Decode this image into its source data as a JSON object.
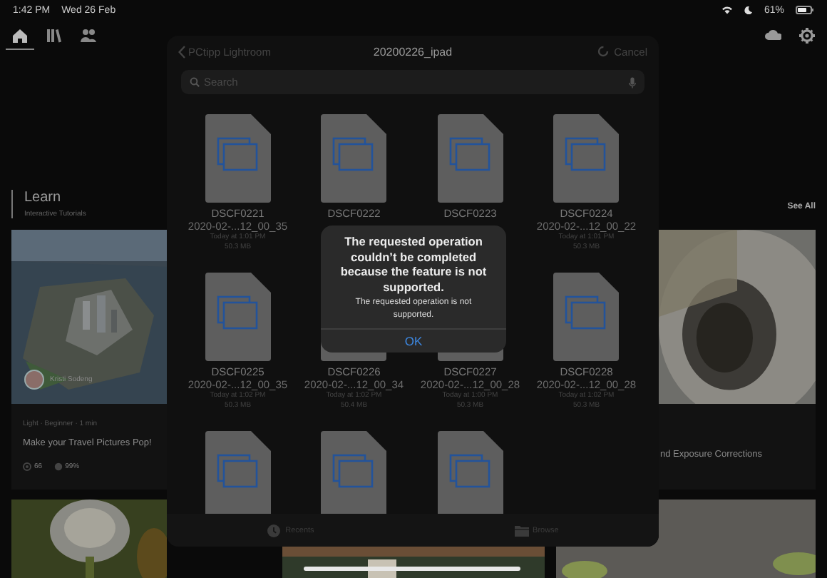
{
  "status_bar": {
    "time": "1:42 PM",
    "date": "Wed 26 Feb",
    "battery_text": "61%"
  },
  "nav": {
    "tabs": [
      {
        "kind": "home",
        "selected": true
      },
      {
        "kind": "library",
        "selected": false
      },
      {
        "kind": "people",
        "selected": false
      }
    ],
    "actions": [
      {
        "kind": "cloud"
      },
      {
        "kind": "settings"
      }
    ]
  },
  "learn": {
    "title": "Learn",
    "subtitle": "Interactive Tutorials",
    "see_all": "See All",
    "cards": [
      {
        "author": "Kristi Sodeng",
        "meta": "Light · Beginner · 1 min",
        "title": "Make your Travel Pictures Pop!",
        "stats": [
          "66",
          "99%"
        ]
      },
      {
        "title": "nd Exposure Corrections"
      }
    ]
  },
  "picker": {
    "back": "PCtipp Lightroom",
    "title": "20200226_ipad",
    "cancel": "Cancel",
    "search": {
      "placeholder": "Search"
    },
    "files": [
      {
        "kind": "file",
        "lines": [
          "DSCF0221",
          "2020-02-...12_00_35",
          "Today at 1:01 PM",
          "50.3 MB"
        ]
      },
      {
        "kind": "file",
        "lines": [
          "DSCF0222"
        ]
      },
      {
        "kind": "file",
        "lines": [
          "DSCF0223"
        ]
      },
      {
        "kind": "file",
        "lines": [
          "DSCF0224",
          "2020-02-...12_00_22",
          "Today at 1:01 PM",
          "50.3 MB"
        ]
      },
      {
        "kind": "file",
        "lines": [
          "DSCF0225",
          "2020-02-...12_00_35",
          "Today at 1:02 PM",
          "50.3 MB"
        ]
      },
      {
        "kind": "file",
        "lines": [
          "DSCF0226",
          "2020-02-...12_00_34",
          "Today at 1:02 PM",
          "50.4 MB"
        ]
      },
      {
        "kind": "file",
        "lines": [
          "DSCF0227",
          "2020-02-...12_00_28",
          "Today at 1:00 PM",
          "50.3 MB"
        ]
      },
      {
        "kind": "file",
        "lines": [
          "DSCF0228",
          "2020-02-...12_00_28",
          "Today at 1:02 PM",
          "50.3 MB"
        ]
      },
      {
        "kind": "file"
      },
      {
        "kind": "file"
      },
      {
        "kind": "file"
      }
    ],
    "tabs": [
      {
        "kind": "recents",
        "label": "Recents",
        "selected": false
      },
      {
        "kind": "browse",
        "label": "Browse",
        "selected": false
      }
    ]
  },
  "alert": {
    "title": "The requested operation couldn’t be completed because the feature is not supported.",
    "message": "The requested operation is not supported.",
    "button": "OK"
  }
}
